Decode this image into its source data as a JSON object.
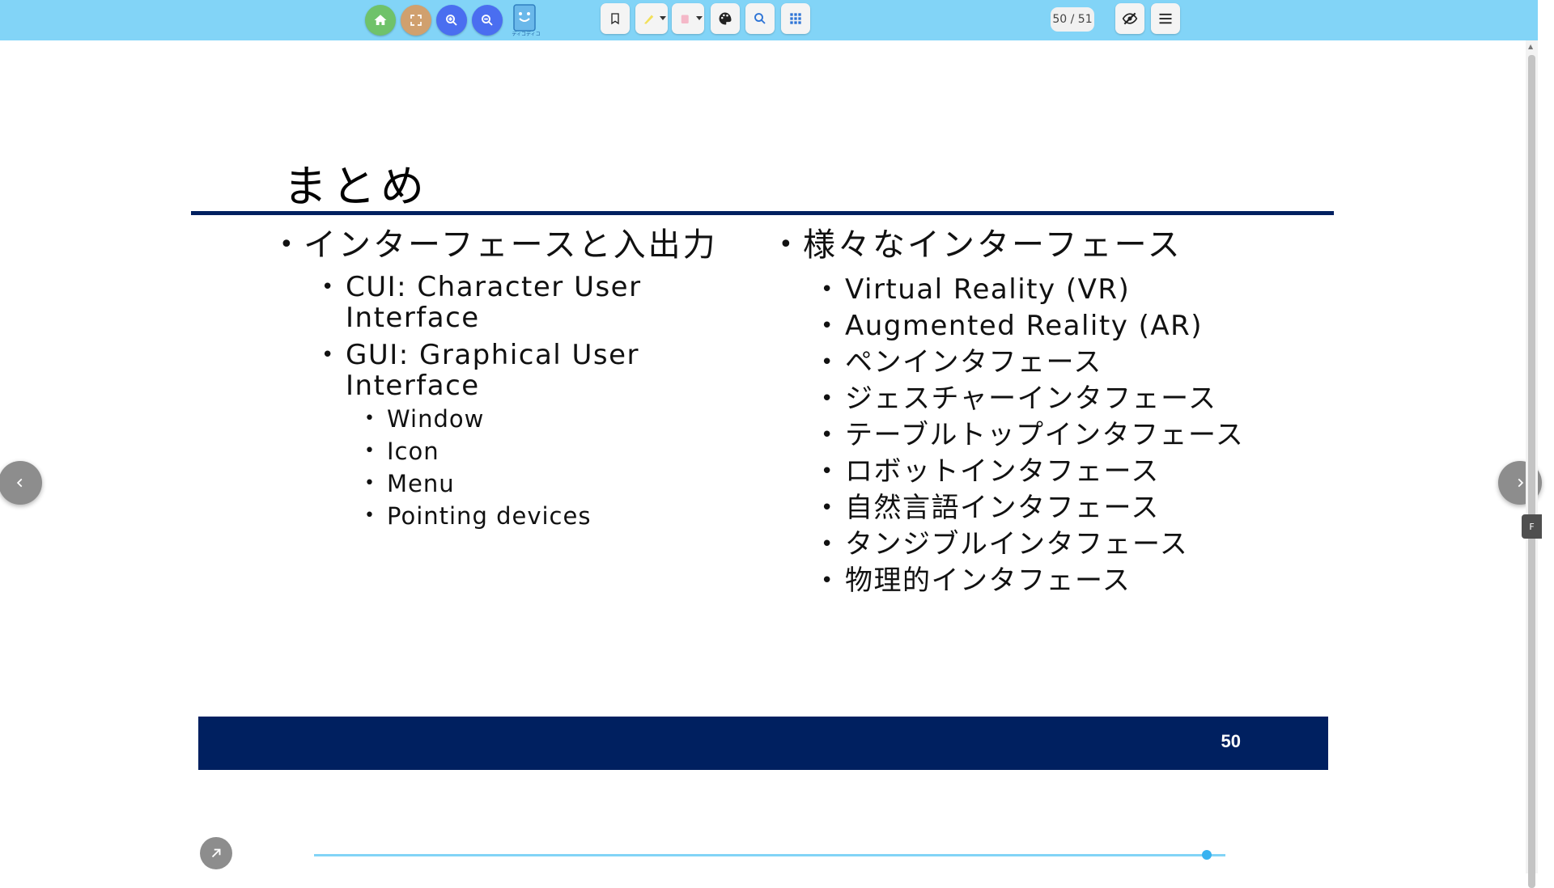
{
  "toolbar": {
    "page_indicator": "50 / 51",
    "logo_text": "ディコディコ",
    "colors": {
      "bar": "#82d4f7",
      "home": "#6fc26a",
      "fullscreen": "#d0a06e",
      "zoom": "#4a6ef0"
    },
    "icons": [
      "home-icon",
      "fullscreen-icon",
      "zoom-in-icon",
      "zoom-out-icon",
      "bookmark-icon",
      "highlighter-icon",
      "eraser-icon",
      "palette-icon",
      "search-icon",
      "grid-icon",
      "hide-icon",
      "menu-icon"
    ]
  },
  "slide": {
    "title": "まとめ",
    "left": {
      "heading": "インターフェースと入出力",
      "items": [
        "CUI: Character User Interface",
        "GUI: Graphical User Interface"
      ],
      "gui_subitems": [
        "Window",
        "Icon",
        "Menu",
        "Pointing devices"
      ]
    },
    "right": {
      "heading": "様々なインターフェース",
      "items": [
        "Virtual Reality (VR)",
        "Augmented Reality (AR)",
        "ペンインタフェース",
        "ジェスチャーインタフェース",
        "テーブルトップインタフェース",
        "ロボットインタフェース",
        "自然言語インタフェース",
        "タンジブルインタフェース",
        "物理的インタフェース"
      ]
    },
    "footer_number": "50",
    "accent_color": "#002060"
  },
  "navigation": {
    "progress": 0.98,
    "side_tab_label": "F"
  }
}
